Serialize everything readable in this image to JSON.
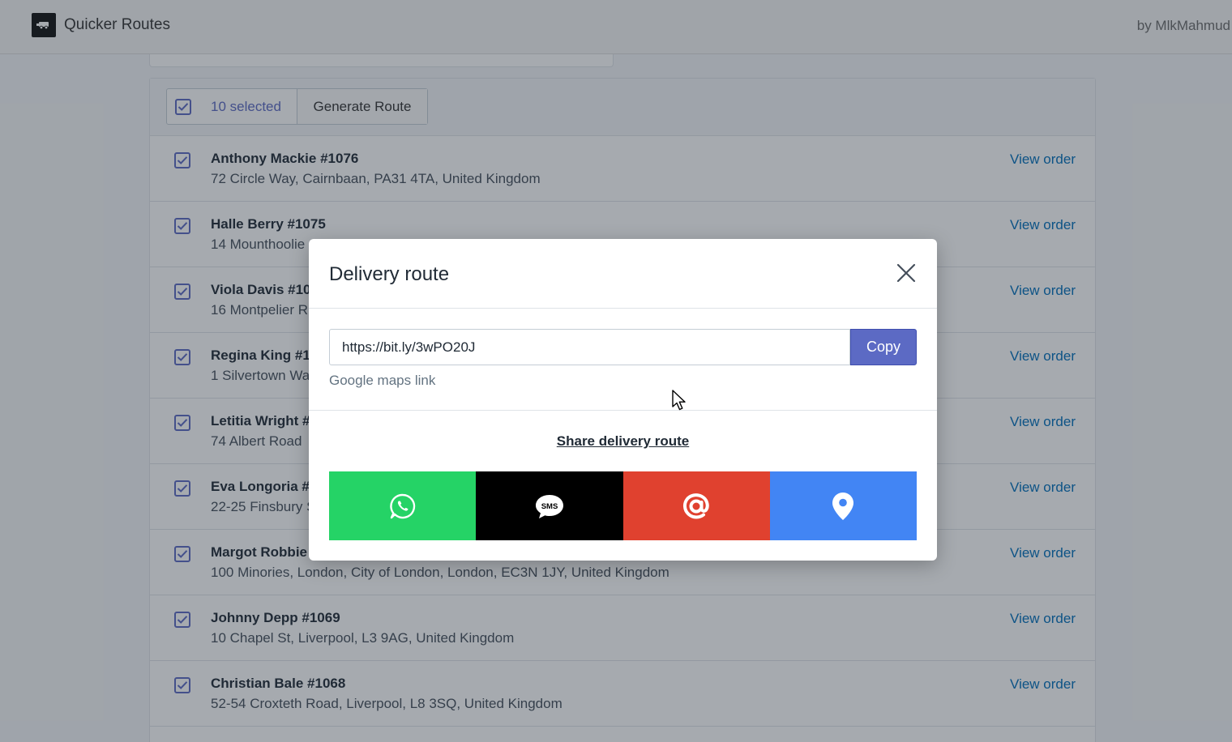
{
  "app": {
    "title": "Quicker Routes",
    "author": "by MlkMahmud"
  },
  "bulk": {
    "selected_label": "10 selected",
    "generate_label": "Generate Route"
  },
  "orders": [
    {
      "name": "Anthony Mackie #1076",
      "address": "72 Circle Way, Cairnbaan, PA31 4TA, United Kingdom",
      "link": "View order"
    },
    {
      "name": "Halle Berry #1075",
      "address": "14 Mounthoolie",
      "link": "View order"
    },
    {
      "name": "Viola Davis #10",
      "address": "16 Montpelier R",
      "link": "View order"
    },
    {
      "name": "Regina King #1",
      "address": "1 Silvertown Wa",
      "link": "View order"
    },
    {
      "name": "Letitia Wright #",
      "address": "74 Albert Road",
      "link": "View order"
    },
    {
      "name": "Eva Longoria #",
      "address": "22-25 Finsbury S",
      "link": "View order"
    },
    {
      "name": "Margot Robbie",
      "address": "100 Minories, London, City of London, London, EC3N 1JY, United Kingdom",
      "link": "View order"
    },
    {
      "name": "Johnny Depp #1069",
      "address": "10 Chapel St, Liverpool, L3 9AG, United Kingdom",
      "link": "View order"
    },
    {
      "name": "Christian Bale #1068",
      "address": "52-54 Croxteth Road, Liverpool, L8 3SQ, United Kingdom",
      "link": "View order"
    }
  ],
  "modal": {
    "title": "Delivery route",
    "url_value": "https://bit.ly/3wPO20J",
    "copy_label": "Copy",
    "help_text": "Google maps link",
    "share_title": "Share delivery route",
    "share_buttons": [
      {
        "icon": "whatsapp-icon",
        "color": "#25d366"
      },
      {
        "icon": "sms-icon",
        "color": "#000000",
        "icon_text": "SMS"
      },
      {
        "icon": "email-at-icon",
        "color": "#e0412f"
      },
      {
        "icon": "map-pin-icon",
        "color": "#4285f4"
      }
    ]
  },
  "colors": {
    "accent": "#5c6ac4",
    "link": "#006fbb"
  }
}
